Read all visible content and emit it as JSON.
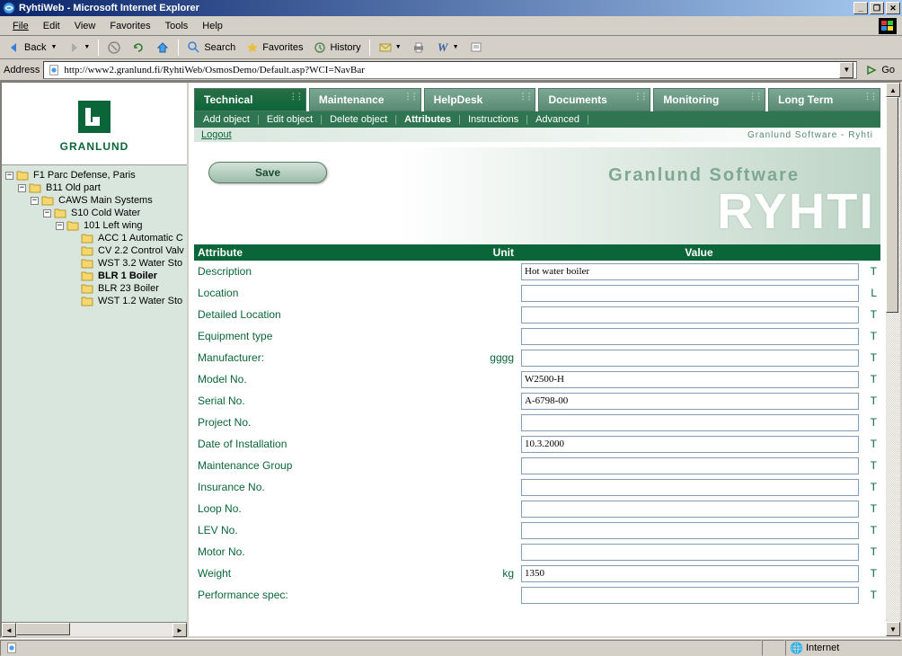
{
  "window": {
    "title": "RyhtiWeb - Microsoft Internet Explorer"
  },
  "menu": {
    "file": "File",
    "edit": "Edit",
    "view": "View",
    "favorites": "Favorites",
    "tools": "Tools",
    "help": "Help"
  },
  "toolbar": {
    "back": "Back",
    "search": "Search",
    "favorites": "Favorites",
    "history": "History"
  },
  "address": {
    "label": "Address",
    "url": "http://www2.granlund.fi/RyhtiWeb/OsmosDemo/Default.asp?WCI=NavBar",
    "go": "Go"
  },
  "logo": {
    "text": "GRANLUND"
  },
  "tree": {
    "n1": "F1   Parc Defense, Paris",
    "n2": "B11   Old part",
    "n3": "CAWS   Main Systems",
    "n4": "S10   Cold Water",
    "n5": "101   Left wing",
    "n6": "ACC 1  Automatic C",
    "n7": "CV 2.2  Control Valv",
    "n8": "WST 3.2  Water Sto",
    "n9": "BLR 1  Boiler",
    "n10": "BLR 23  Boiler",
    "n11": "WST 1.2  Water Sto"
  },
  "tabs": {
    "technical": "Technical",
    "maintenance": "Maintenance",
    "helpdesk": "HelpDesk",
    "documents": "Documents",
    "monitoring": "Monitoring",
    "longterm": "Long Term"
  },
  "submenu": {
    "add": "Add object",
    "edit": "Edit object",
    "delete": "Delete object",
    "attributes": "Attributes",
    "instructions": "Instructions",
    "advanced": "Advanced"
  },
  "logout": {
    "label": "Logout",
    "brand": "Granlund Software  -  Ryhti"
  },
  "banner": {
    "save": "Save",
    "bg1": "Granlund Software",
    "bg2": "RYHTI"
  },
  "headers": {
    "attribute": "Attribute",
    "unit": "Unit",
    "value": "Value"
  },
  "rows": [
    {
      "attr": "Description",
      "unit": "",
      "value": "Hot water boiler",
      "flag": "T"
    },
    {
      "attr": "Location",
      "unit": "",
      "value": "",
      "flag": "L"
    },
    {
      "attr": "Detailed Location",
      "unit": "",
      "value": "",
      "flag": "T"
    },
    {
      "attr": "Equipment type",
      "unit": "",
      "value": "",
      "flag": "T"
    },
    {
      "attr": "Manufacturer:",
      "unit": "gggg",
      "value": "",
      "flag": "T"
    },
    {
      "attr": "Model No.",
      "unit": "",
      "value": "W2500-H",
      "flag": "T"
    },
    {
      "attr": "Serial No.",
      "unit": "",
      "value": "A-6798-00",
      "flag": "T"
    },
    {
      "attr": "Project No.",
      "unit": "",
      "value": "",
      "flag": "T"
    },
    {
      "attr": "Date of Installation",
      "unit": "",
      "value": "10.3.2000",
      "flag": "T"
    },
    {
      "attr": "Maintenance Group",
      "unit": "",
      "value": "",
      "flag": "T"
    },
    {
      "attr": "Insurance No.",
      "unit": "",
      "value": "",
      "flag": "T"
    },
    {
      "attr": "Loop No.",
      "unit": "",
      "value": "",
      "flag": "T"
    },
    {
      "attr": "LEV No.",
      "unit": "",
      "value": "",
      "flag": "T"
    },
    {
      "attr": "Motor No.",
      "unit": "",
      "value": "",
      "flag": "T"
    },
    {
      "attr": "Weight",
      "unit": "kg",
      "value": "1350",
      "flag": "T"
    },
    {
      "attr": "Performance spec:",
      "unit": "",
      "value": "",
      "flag": "T"
    }
  ],
  "status": {
    "zone": "Internet"
  }
}
